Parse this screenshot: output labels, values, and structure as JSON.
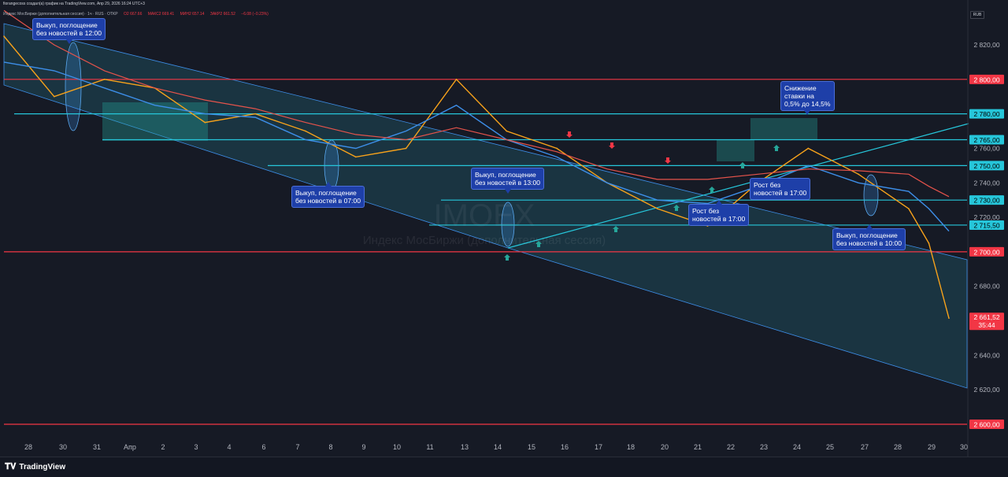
{
  "header": {
    "top_text": "fiorangecoss создал(а) график на TradingView.com, Апр 29, 2026 16:24 UTC+3",
    "legend_name": "Индекс МосБиржи (дополнительная сессия) · 1ч · RUS · OTKP",
    "legend_values": [
      "O2 667.66",
      "МАКС2 669.41",
      "МИН2 657.14",
      "ЗАКР2 661.52",
      "−6.08 (−0.23%)"
    ]
  },
  "currency_label": "RUB",
  "watermark": {
    "symbol": "IMOEX",
    "name": "Индекс МосБиржи (дополнительная сессия)"
  },
  "footer": {
    "logo_text": "TradingView"
  },
  "colors": {
    "background": "#161a25",
    "red_level": "#f23645",
    "cyan_level": "#26c6da",
    "price_line": "#f7a21b",
    "ma_blue": "#3d8ee8",
    "ma_red": "#e5534b",
    "up_arrow": "#26a69a",
    "down_arrow": "#f23645",
    "annotation": "#1e3fa8"
  },
  "annotations": [
    {
      "text": "Выкуп, поглощение\nбез новостей в 12:00"
    },
    {
      "text": "Выкуп, поглощение\nбез новостей в 07:00"
    },
    {
      "text": "Выкуп, поглощение\nбез новостей в 13:00"
    },
    {
      "text": "Снижение\nставки на\n0,5% до 14,5%"
    },
    {
      "text": "Рост без\nновостей в 17:00"
    },
    {
      "text": "Рост без\nновостей в 17:00"
    },
    {
      "text": "Выкуп, поглощение\nбез новостей в 10:00"
    }
  ],
  "chart_data": {
    "type": "line",
    "title": "Индекс МосБиржи (дополнительная сессия)",
    "xlabel": "",
    "ylabel": "",
    "ylim": [
      2600,
      2840
    ],
    "x_ticks": [
      "28",
      "30",
      "31",
      "Апр",
      "2",
      "3",
      "4",
      "6",
      "7",
      "8",
      "9",
      "10",
      "11",
      "13",
      "14",
      "15",
      "16",
      "17",
      "18",
      "20",
      "21",
      "22",
      "23",
      "24",
      "25",
      "27",
      "28",
      "29",
      "30"
    ],
    "y_ticks": [
      "2 820,00",
      "2 800,00",
      "2 780,00",
      "2 760,00",
      "2 740,00",
      "2 720,00",
      "2 700,00",
      "2 680,00",
      "2 660,00",
      "2 640,00",
      "2 620,00",
      "2 600,00"
    ],
    "horizontal_levels": [
      {
        "value": 2800,
        "label": "2 800,00",
        "color": "red"
      },
      {
        "value": 2780,
        "label": "2 780,00",
        "color": "cyan"
      },
      {
        "value": 2765,
        "label": "2 765,00",
        "color": "cyan"
      },
      {
        "value": 2750,
        "label": "2 750,00",
        "color": "cyan"
      },
      {
        "value": 2730,
        "label": "2 730,00",
        "color": "cyan"
      },
      {
        "value": 2715.5,
        "label": "2 715,50",
        "color": "cyan"
      },
      {
        "value": 2700,
        "label": "2 700,00",
        "color": "red"
      },
      {
        "value": 2600,
        "label": "2 600,00",
        "color": "red"
      }
    ],
    "last_price": {
      "value": 2661.52,
      "label": "2 661,52",
      "timer": "35:44"
    },
    "x": [
      0,
      1.5,
      3,
      4.5,
      6,
      7.5,
      9,
      10.5,
      12,
      13.5,
      15,
      16.5,
      18,
      19.5,
      21,
      22.5,
      24,
      25.5,
      27,
      27.6,
      28.2
    ],
    "series": [
      {
        "values": [
          2825,
          2790,
          2800,
          2795,
          2775,
          2780,
          2770,
          2755,
          2760,
          2800,
          2770,
          2760,
          2740,
          2725,
          2715,
          2740,
          2760,
          2745,
          2725,
          2705,
          2661.5
        ]
      },
      {
        "values": [
          2810,
          2805,
          2795,
          2785,
          2780,
          2778,
          2765,
          2760,
          2770,
          2785,
          2765,
          2755,
          2740,
          2730,
          2728,
          2738,
          2750,
          2740,
          2735,
          2725,
          2712
        ]
      },
      {
        "values": [
          2840,
          2820,
          2805,
          2795,
          2788,
          2783,
          2775,
          2768,
          2765,
          2772,
          2765,
          2758,
          2748,
          2742,
          2742,
          2745,
          2748,
          2747,
          2745,
          2738,
          2732
        ]
      }
    ]
  }
}
